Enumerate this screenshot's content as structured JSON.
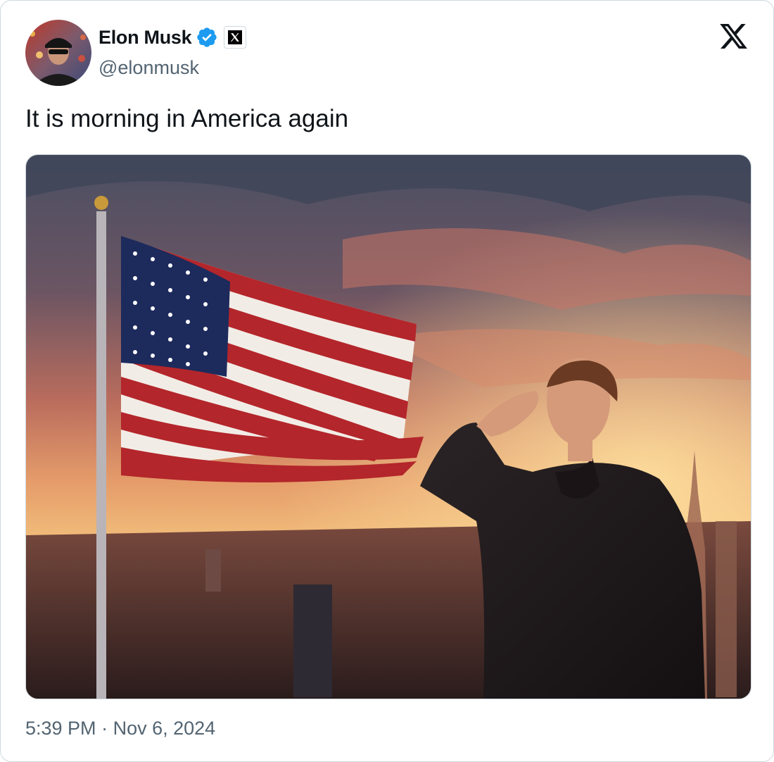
{
  "author": {
    "name": "Elon Musk",
    "handle": "@elonmusk",
    "verified_icon": "verified-badge-icon",
    "affiliation_icon": "x-affiliate-icon",
    "avatar": "profile-photo"
  },
  "platform_logo": "x-logo-icon",
  "tweet": {
    "text": "It is morning in America again",
    "media": "AI-generated image of a man saluting beside a waving American flag over a city skyline at sunset"
  },
  "meta": {
    "time": "5:39 PM",
    "separator": "·",
    "date": "Nov 6, 2024"
  },
  "colors": {
    "text_primary": "#0f1419",
    "text_secondary": "#536471",
    "verified_blue": "#1d9bf0",
    "border": "#cfd9de"
  }
}
